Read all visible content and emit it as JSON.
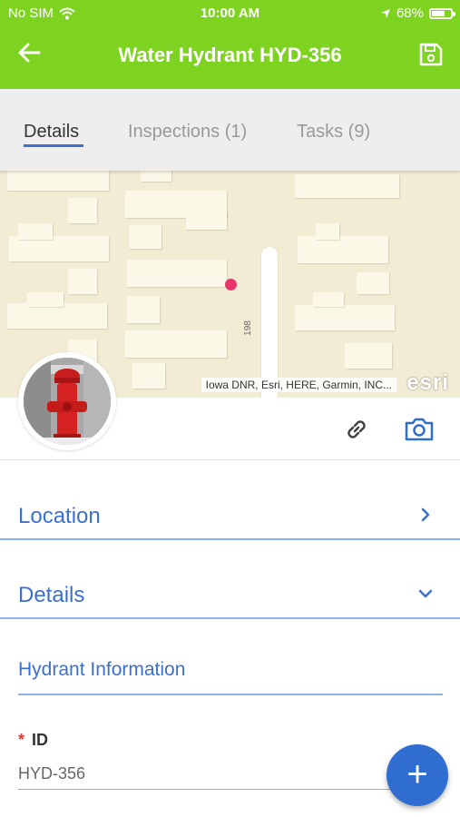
{
  "status_bar": {
    "carrier": "No SIM",
    "time": "10:00 AM",
    "battery_percent_text": "68%",
    "battery_level": 0.68
  },
  "nav": {
    "title": "Water Hydrant HYD-356",
    "back_icon": "arrow-left-icon",
    "save_icon": "save-icon"
  },
  "tabs": [
    {
      "label": "Details",
      "active": true
    },
    {
      "label": "Inspections (1)",
      "active": false
    },
    {
      "label": "Tasks (9)",
      "active": false
    }
  ],
  "map": {
    "road_label": "198",
    "attribution": "Iowa DNR, Esri, HERE, Garmin, INC...",
    "logo_text": "esri"
  },
  "actions": {
    "link_icon": "link-icon",
    "camera_icon": "camera-icon"
  },
  "sections": [
    {
      "label": "Location",
      "state": "collapsed"
    },
    {
      "label": "Details",
      "state": "expanded"
    }
  ],
  "group_title": "Hydrant Information",
  "field": {
    "required_marker": "*",
    "label": "ID",
    "value": "HYD-356"
  },
  "fab_label": "+",
  "colors": {
    "header_green": "#7ed321",
    "accent_blue": "#3b6fd0",
    "fab_blue": "#2f6dd0",
    "pin_red": "#e8336b"
  }
}
